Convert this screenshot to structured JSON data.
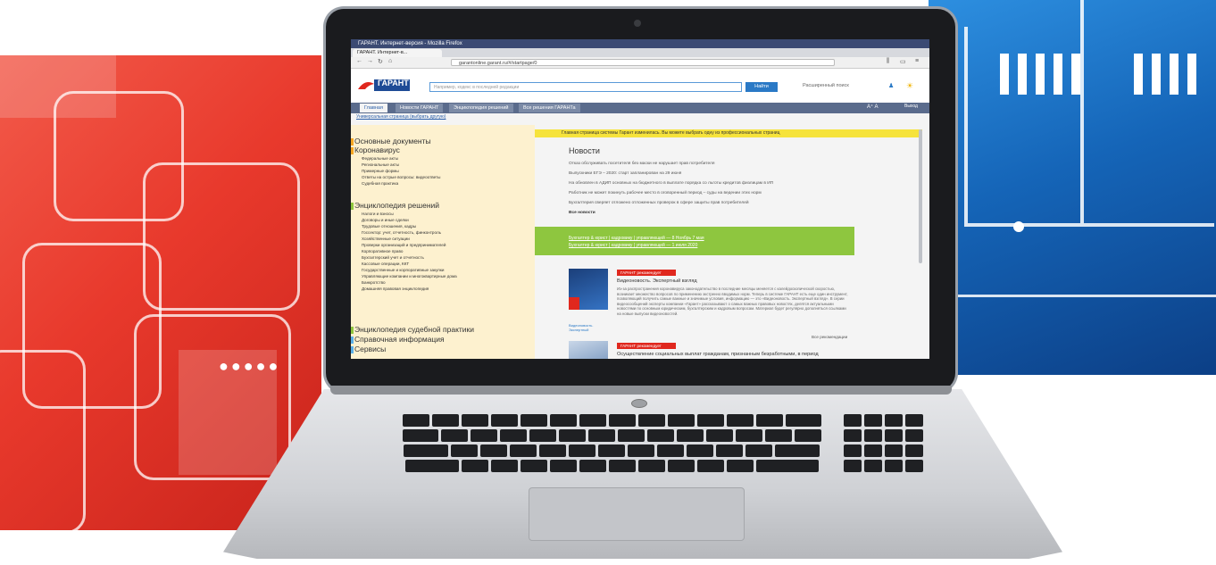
{
  "browser": {
    "window_title": "ГАРАНТ. Интернет-версия - Mozilla Firefox",
    "tab_label": "ГАРАНТ. Интернет-в...",
    "url": "garantonline.garant.ru/#/startpage/0"
  },
  "site": {
    "logo_text": "ГАРАНТ",
    "search_placeholder": "Например, кодекс в последней редакции",
    "find_button": "Найти",
    "advanced_search": "Расширенный поиск",
    "font_size_label": "A⁺ A",
    "exit_label": "Выход",
    "tabs": [
      {
        "label": "Главная",
        "active": true
      },
      {
        "label": "Новости ГАРАНТ",
        "active": false
      },
      {
        "label": "Энциклопедия решений",
        "active": false
      },
      {
        "label": "Все решения ГАРАНТа",
        "active": false
      }
    ],
    "universal_link": "Универсальная страница (выбрать другую)"
  },
  "sidebar": {
    "sections": [
      {
        "title": "Основные документы",
        "items": []
      },
      {
        "title": "Коронавирус",
        "items": [
          "Федеральные акты",
          "Региональные акты",
          "Примерные формы",
          "Ответы на острые вопросы: видеоответы",
          "Судебная практика"
        ]
      },
      {
        "title": "Энциклопедия решений",
        "items": [
          "Налоги и взносы",
          "Договоры и иные сделки",
          "Трудовые отношения, кадры",
          "Госсектор: учет, отчетность, финконтроль",
          "Хозяйственные ситуации",
          "Проверки организаций и предпринимателей",
          "Корпоративное право",
          "Бухгалтерский учет и отчетность",
          "Кассовые операции, ККТ",
          "Государственные и корпоративные закупки",
          "Управляющие компании и многоквартирные дома",
          "Банкротство",
          "Домашняя правовая энциклопедия"
        ]
      },
      {
        "title": "Энциклопедия судебной практики",
        "items": []
      },
      {
        "title": "Справочная информация",
        "items": []
      },
      {
        "title": "Сервисы",
        "items": []
      }
    ]
  },
  "main": {
    "notice": "Главная страница системы Гарант изменилась. Вы можете выбрать одну из профессиональных страниц",
    "news_title": "Новости",
    "news": [
      "Отказ обслуживать посетителя без маски не нарушает прав потребителя",
      "Выпускники ЕГЭ – 2020: старт запланирован на 29 июня",
      "На обновлен в АДИП основных на бюджетного в выплате порядка со льготы кредитов физлицам в ИП",
      "Работник не может покинуть рабочее место в оговоренный период – суды на ведении этих норм",
      "Бухгалтерия сверяет отложено отложенных проверок в сфере защиты прав потребителей",
      "Все новости"
    ],
    "green_links": [
      "Бухгалтер & юрист | кадровику | управляющей — 8 Ноябрь 7 мая",
      "Бухгалтер & юрист | кадровику | управляющей — 1 июля 2020"
    ],
    "recommendations": [
      {
        "badge": "ГАРАНТ рекомендует",
        "title": "Видеоновость. Экспертный взгляд",
        "body": "Из-за распространения коронавируса законодательство в последние месяцы меняется с калейдоскопической скоростью, возникает множество вопросов по применению экстренно вводимых норм. Теперь в системе ГАРАНТ есть еще один инструмент, позволяющий получить самые важные и значимые условия, информацию — это «Видеоновость. Экспертный взгляд». В серии видеосообщений эксперты компании «Гарант» рассказывают о самых важных правовых новостях, делятся актуальными новостями по основным юридическим, бухгалтерским и кадровым вопросам. Материал будет регулярно дополняться ссылками на новые выпуски видеоновостей.",
        "thumb_caption": "Видеоновость. Экспертный",
        "more": "Все рекомендации"
      },
      {
        "badge": "ГАРАНТ рекомендует",
        "title": "Осуществление социальных выплат гражданам, признанным безработными, в период"
      }
    ]
  },
  "colors": {
    "accent_blue": "#2a79c6",
    "notice_yellow": "#f6e33c",
    "green_band": "#8ec63f",
    "badge_red": "#e0281e",
    "sidebar_bg": "#fdf1cf"
  }
}
